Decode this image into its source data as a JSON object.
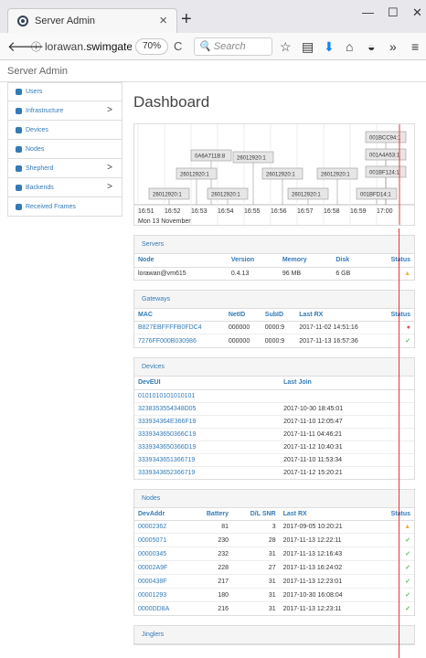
{
  "browser": {
    "tab_title": "Server Admin",
    "tab_close": "×",
    "new_tab": "+",
    "url_prefix": "lorawan.",
    "url_host": "swimgate.c",
    "zoom": "70%",
    "search_placeholder": "Search"
  },
  "app": {
    "header": "Server Admin",
    "page_title": "Dashboard"
  },
  "sidebar": {
    "items": [
      {
        "label": "Users",
        "icon": "user-icon",
        "chevron": ""
      },
      {
        "label": "Infrastructure",
        "icon": "sitemap-icon",
        "chevron": ">"
      },
      {
        "label": "Devices",
        "icon": "device-icon",
        "chevron": ""
      },
      {
        "label": "Nodes",
        "icon": "wifi-icon",
        "chevron": ""
      },
      {
        "label": "Shepherd",
        "icon": "gear-icon",
        "chevron": ">"
      },
      {
        "label": "Backends",
        "icon": "chart-icon",
        "chevron": ">"
      },
      {
        "label": "Received Frames",
        "icon": "cloud-icon",
        "chevron": ""
      }
    ]
  },
  "timeline": {
    "ticks": [
      "16:51",
      "16:52",
      "16:53",
      "16:54",
      "16:55",
      "16:56",
      "16:57",
      "16:58",
      "16:59",
      "17:00"
    ],
    "date": "Mon 13 November",
    "labels": [
      "001BCC94:1",
      "001A4A53:1",
      "001BF124:1",
      "001BFD14:1",
      "0A6A711B:8",
      "26012920:1",
      "26012920:1",
      "26012920:1",
      "26012920:1",
      "26012920:1",
      "26012920:1",
      "26012920:1"
    ]
  },
  "servers": {
    "title": "Servers",
    "headers": [
      "Node",
      "Version",
      "Memory",
      "Disk",
      "Status"
    ],
    "rows": [
      {
        "node": "lorawan@vm615",
        "version": "0.4.13",
        "memory": "96 MB",
        "disk": "6 GB",
        "status": "▲"
      }
    ]
  },
  "gateways": {
    "title": "Gateways",
    "headers": [
      "MAC",
      "NetID",
      "SubID",
      "Last RX",
      "Status"
    ],
    "rows": [
      {
        "mac": "B827EBFFFFB0FDC4",
        "netid": "000000",
        "subid": "0000:9",
        "last_rx": "2017-11-02 14:51:16",
        "status": "●"
      },
      {
        "mac": "7276FF000B030986",
        "netid": "000000",
        "subid": "0000:9",
        "last_rx": "2017-11-13 16:57:36",
        "status": "✓"
      }
    ]
  },
  "devices": {
    "title": "Devices",
    "headers": [
      "DevEUI",
      "Last Join"
    ],
    "rows": [
      {
        "deveui": "0101010101010101",
        "last_join": ""
      },
      {
        "deveui": "3238353554348D05",
        "last_join": "2017-10-30 18:45:01"
      },
      {
        "deveui": "333934364E366F19",
        "last_join": "2017-11-10 12:05:47"
      },
      {
        "deveui": "3339343650366C19",
        "last_join": "2017-11-11 04:46:21"
      },
      {
        "deveui": "3339343650366D19",
        "last_join": "2017-11-12 10:40:31"
      },
      {
        "deveui": "3339343651366719",
        "last_join": "2017-11-10 11:53:34"
      },
      {
        "deveui": "3339343652366719",
        "last_join": "2017-11-12 15:20:21"
      }
    ]
  },
  "nodes": {
    "title": "Nodes",
    "headers": [
      "DevAddr",
      "Battery",
      "D/L SNR",
      "Last RX",
      "Status"
    ],
    "rows": [
      {
        "addr": "00002362",
        "battery": "81",
        "snr": "3",
        "last_rx": "2017-09-05 10:20:21",
        "status": "▲"
      },
      {
        "addr": "00005071",
        "battery": "230",
        "snr": "28",
        "last_rx": "2017-11-13 12:22:11",
        "status": "✓"
      },
      {
        "addr": "00000345",
        "battery": "232",
        "snr": "31",
        "last_rx": "2017-11-13 12:16:43",
        "status": "✓"
      },
      {
        "addr": "00002A9F",
        "battery": "228",
        "snr": "27",
        "last_rx": "2017-11-13 16:24:02",
        "status": "✓"
      },
      {
        "addr": "0000438F",
        "battery": "217",
        "snr": "31",
        "last_rx": "2017-11-13 12:23:01",
        "status": "✓"
      },
      {
        "addr": "00001293",
        "battery": "180",
        "snr": "31",
        "last_rx": "2017-10-30 16:08:04",
        "status": "✓"
      },
      {
        "addr": "0000DD8A",
        "battery": "216",
        "snr": "31",
        "last_rx": "2017-11-13 12:23:11",
        "status": "✓"
      }
    ]
  },
  "jinglers": {
    "title": "Jinglers"
  }
}
